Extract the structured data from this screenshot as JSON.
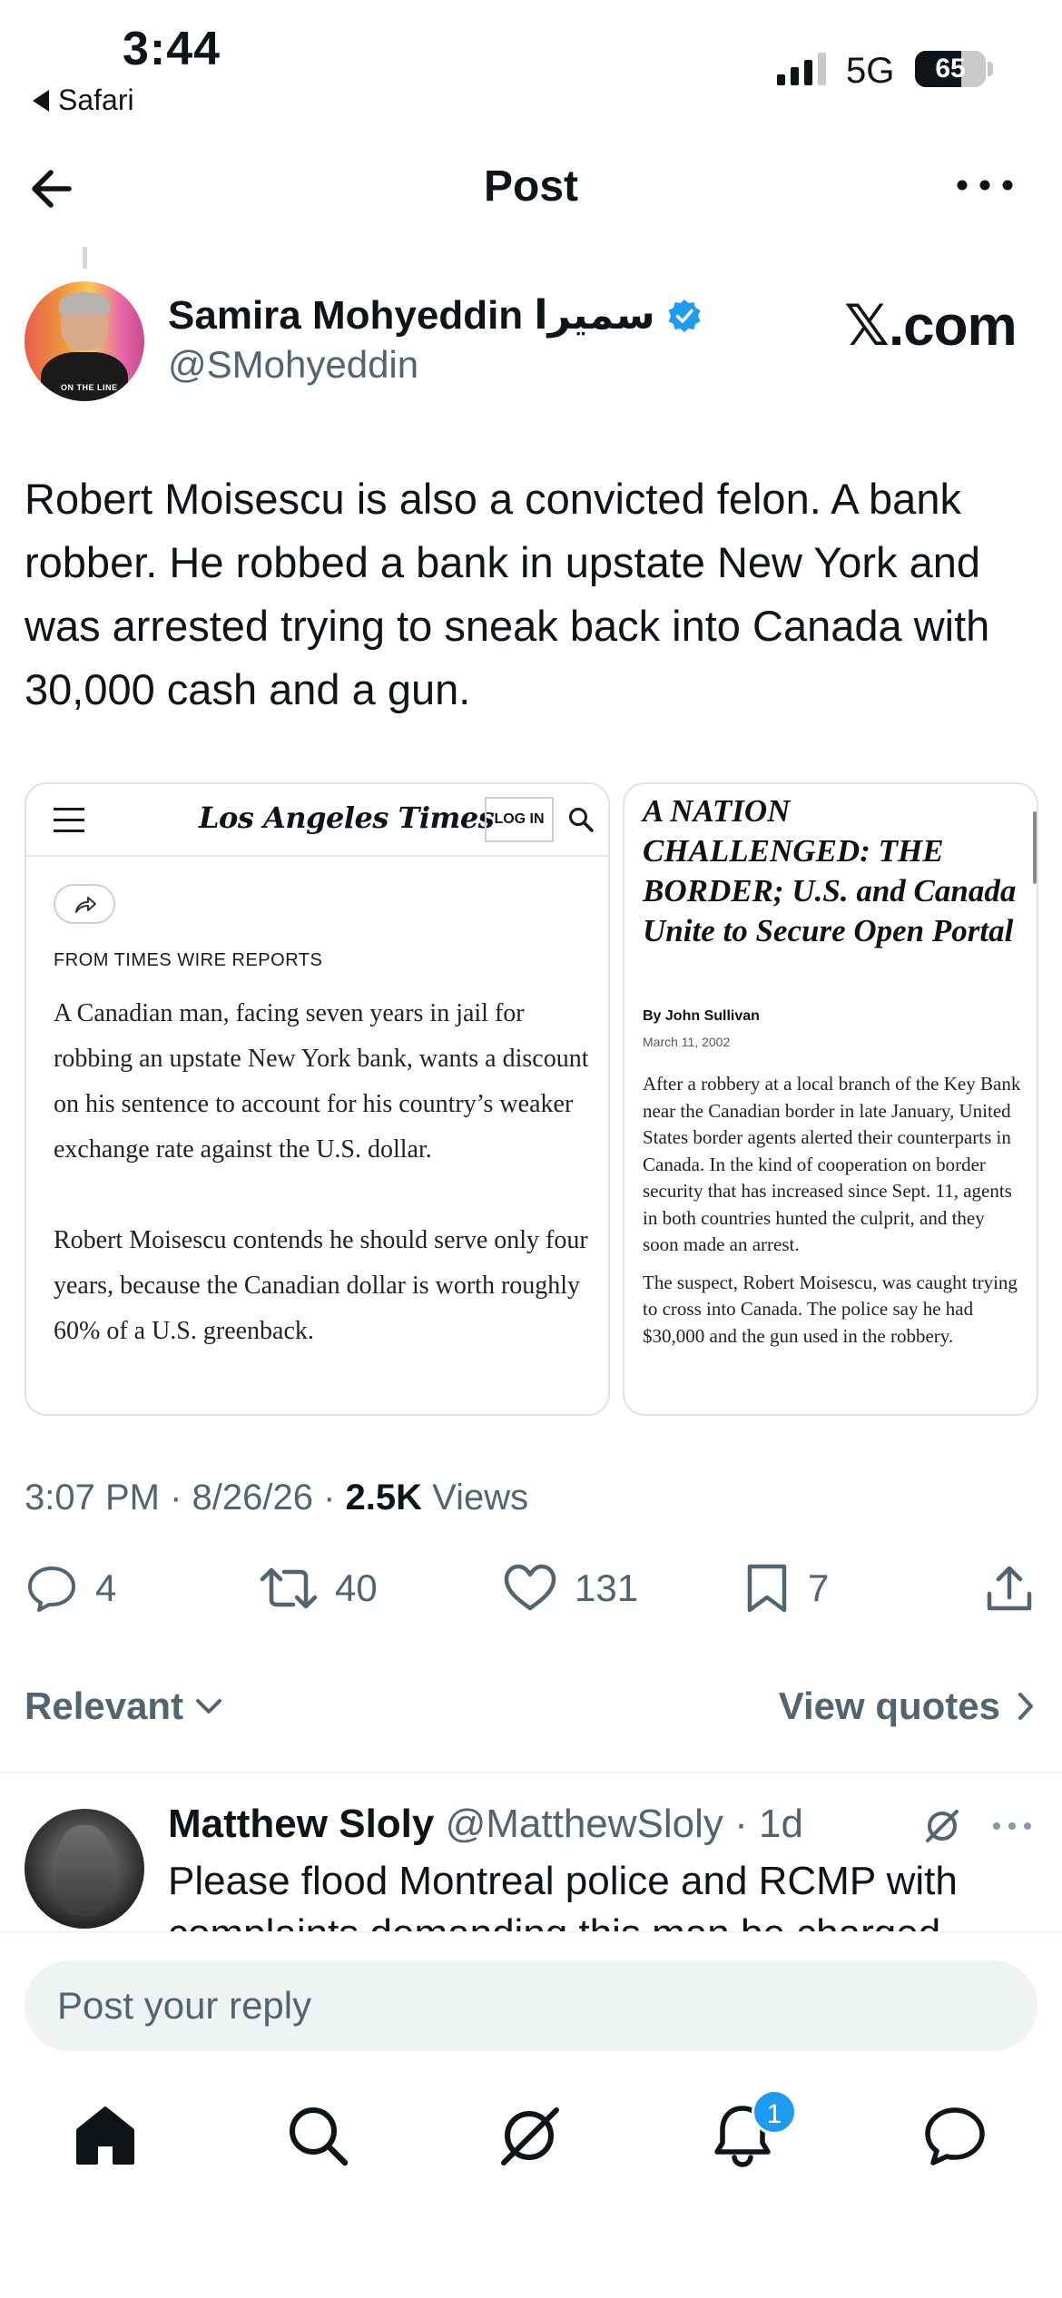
{
  "status_bar": {
    "time": "3:44",
    "back_app": "Safari",
    "network": "5G",
    "battery_percent": 65
  },
  "nav": {
    "title": "Post",
    "back_icon": "arrow-left-icon",
    "more_icon": "more-horizontal-icon"
  },
  "post": {
    "author_name": "Samira Mohyeddin سميرا",
    "author_handle": "@SMohyeddin",
    "source_label": "𝕏.com",
    "text": "Robert Moisescu is also a convicted felon. A bank robber. He robbed a bank in upstate New York and was arrested trying to sneak back into Canada with 30,000 cash and a gun.",
    "timestamp": "3:07 PM · 8/26/26 · ",
    "views_count": "2.5K",
    "views_label": " Views",
    "stats": {
      "replies": "4",
      "reposts": "40",
      "likes": "131",
      "bookmarks": "7"
    }
  },
  "media_left": {
    "logo": "Los Angeles Times",
    "login": "LOG IN",
    "section": "FROM TIMES WIRE REPORTS",
    "para1": "A Canadian man, facing seven years in jail for robbing an upstate New York bank, wants a discount on his sentence to account for his country’s weaker exchange rate against the U.S. dollar.",
    "para2": "Robert Moisescu contends he should serve only four years, because the Canadian dollar is worth roughly 60% of a U.S. greenback."
  },
  "media_right": {
    "headline": "A NATION CHALLENGED: THE BORDER; U.S. and Canada Unite to Secure Open Portal",
    "byline": "By John Sullivan",
    "date": "March 11, 2002",
    "para1": "After a robbery at a local branch of the Key Bank near the Canadian border in late January, United States border agents alerted their counterparts in Canada. In the kind of cooperation on border security that has increased since Sept. 11, agents in both countries hunted the culprit, and they soon made an arrest.",
    "para2": "The suspect, Robert Moisescu, was caught trying to cross into Canada. The police say he had $30,000 and the gun used in the robbery."
  },
  "filters": {
    "sort_label": "Relevant",
    "view_quotes": "View quotes"
  },
  "reply": {
    "name": "Matthew Sloly",
    "handle_time": " @MatthewSloly · 1d",
    "text": "Please flood Montreal police and RCMP with complaints demanding this man be charged"
  },
  "composer": {
    "placeholder": "Post your reply"
  },
  "tab_bar": {
    "items": [
      "home-icon",
      "search-icon",
      "grok-icon",
      "notifications-icon",
      "messages-icon"
    ],
    "notification_badge": "1"
  },
  "colors": {
    "text_primary": "#0f1419",
    "text_secondary": "#536471",
    "accent": "#1d9bf0",
    "composer_bg": "#eff3f4"
  }
}
